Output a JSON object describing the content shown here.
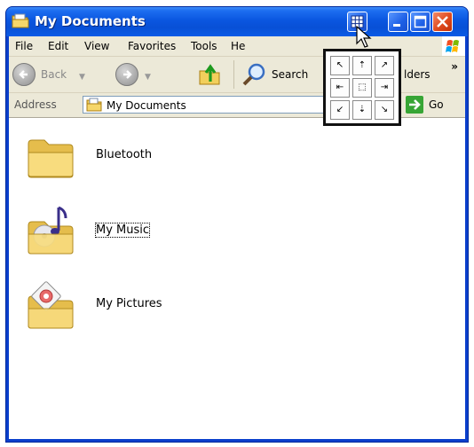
{
  "window": {
    "title": "My Documents",
    "icon": "folder-documents-icon"
  },
  "title_buttons": [
    "snap-layout-icon",
    "minimize-icon",
    "maximize-icon",
    "close-icon"
  ],
  "menu": {
    "items": [
      "File",
      "Edit",
      "View",
      "Favorites",
      "Tools",
      "He"
    ]
  },
  "toolbar": {
    "back_label": "Back",
    "search_label": "Search",
    "folders_label": "lders",
    "overflow": "»"
  },
  "address": {
    "label": "Address",
    "value": "My Documents",
    "go_label": "Go"
  },
  "files": [
    {
      "name": "Bluetooth",
      "icon": "folder-icon"
    },
    {
      "name": "My Music",
      "icon": "music-folder-icon"
    },
    {
      "name": "My Pictures",
      "icon": "pictures-folder-icon"
    }
  ],
  "snap_grid": {
    "cells": [
      "↖",
      "⇡",
      "↗",
      "⇤",
      "⬚",
      "⇥",
      "↙",
      "⇣",
      "↘"
    ]
  },
  "colors": {
    "titlebar": "#0a56e0",
    "close": "#e04a1d",
    "chrome": "#ece9d8",
    "go": "#37a535"
  }
}
